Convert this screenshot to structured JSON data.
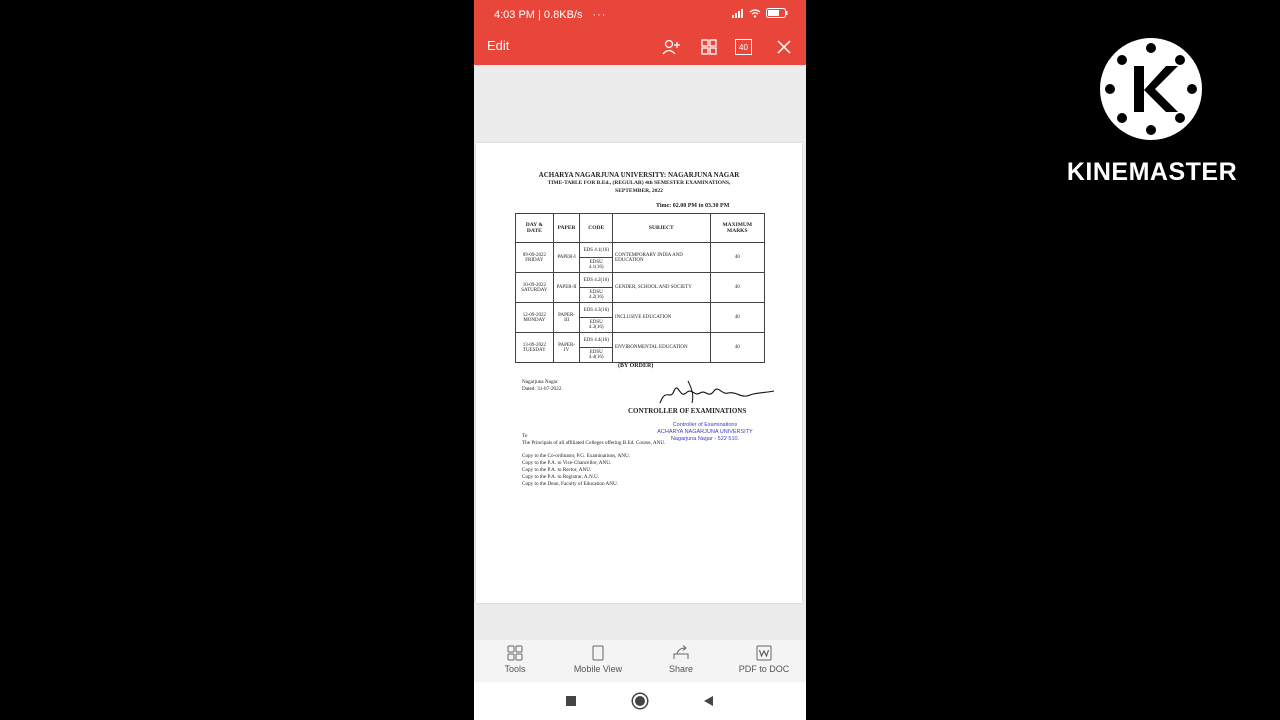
{
  "status_bar": {
    "time": "4:03 PM | 0.8KB/s",
    "dots": "···",
    "battery": "59"
  },
  "toolbar": {
    "edit_label": "Edit",
    "page_count": "40"
  },
  "document": {
    "title_line1": "ACHARYA NAGARJUNA UNIVERSITY: NAGARJUNA NAGAR",
    "title_line2": "TIME-TABLE FOR B.Ed., (REGULAR) 4th SEMESTER EXAMINATIONS,",
    "title_line3": "SEPTEMBER, 2022",
    "time_line": "Time: 02.00 PM to 03.30 PM",
    "table_headers": [
      "DAY & DATE",
      "PAPER",
      "CODE",
      "SUBJECT",
      "MAXIMUM MARKS"
    ],
    "rows": [
      {
        "date": "09-09-2022",
        "day": "FRIDAY",
        "paper": "PAPER-I",
        "code1": "EDS 4.1(16)",
        "code2": "EDSU 4.1(16)",
        "subject": "CONTEMPORARY INDIA AND EDUCATION",
        "marks": "40"
      },
      {
        "date": "10-09-2022",
        "day": "SATURDAY",
        "paper": "PAPER-II",
        "code1": "EDS 4.2(16)",
        "code2": "EDSU 4.2(16)",
        "subject": "GENDER, SCHOOL AND SOCIETY",
        "marks": "40"
      },
      {
        "date": "12-09-2022",
        "day": "MONDAY",
        "paper": "PAPER-III",
        "code1": "EDS 4.3(16)",
        "code2": "EDSU 4.3(16)",
        "subject": "INCLUSIVE EDUCATION",
        "marks": "40"
      },
      {
        "date": "13-09-2022",
        "day": "TUESDAY",
        "paper": "PAPER-IV",
        "code1": "EDS 4.4(16)",
        "code2": "EDSU 4.4(16)",
        "subject": "ENVIRONMENTAL EDUCATION",
        "marks": "40"
      }
    ],
    "by_order": "(BY ORDER)",
    "place": "Nagarjuna Nagar",
    "dated": "Dated: 31-07-2022.",
    "controller": "CONTROLLER OF EXAMINATIONS",
    "stamp_line1": "Controller of Examinations",
    "stamp_line2": "ACHARYA NAGARJUNA UNIVERSITY",
    "stamp_line3": "Nagarjuna Nagar - 522 510.",
    "to": "To",
    "principals": "The Principals of all affiliated Colleges offering B.Ed. Course, ANU.",
    "copies": [
      "Copy to the Co-ordinator, P.G. Examinations, ANU.",
      "Copy to the P.A. to Vice-Chancellor, ANU.",
      "Copy to the P.A. to Rector, ANU.",
      "Copy to the P.A. to Registrar, A.N.U.",
      "Copy to the Dean, Faculty of Education ANU."
    ]
  },
  "bottom_bar": {
    "tools": "Tools",
    "mobile_view": "Mobile View",
    "share": "Share",
    "pdf_to_doc": "PDF to DOC"
  },
  "watermark": {
    "text": "KINEMASTER"
  },
  "colors": {
    "accent": "#e8463a",
    "stamp_blue": "#3c3ccc"
  }
}
